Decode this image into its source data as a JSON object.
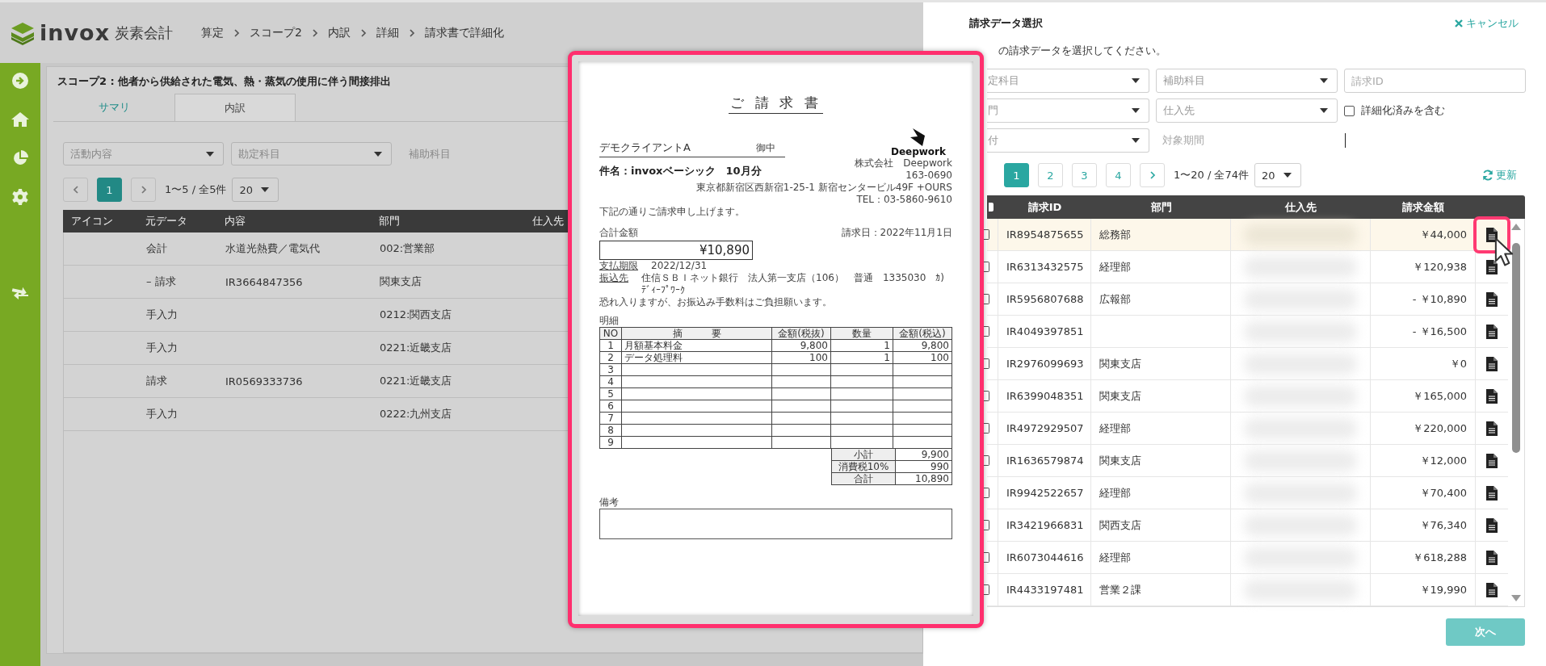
{
  "app": {
    "logo_text": "invox",
    "logo_suffix": "炭素会計",
    "breadcrumb": [
      "算定",
      "スコープ2",
      "内訳",
      "詳細",
      "請求書で詳細化"
    ]
  },
  "page": {
    "title": "スコープ2 : 他者から供給された電気、熱・蒸気の使用に伴う間接排出",
    "tabs": [
      {
        "label": "サマリ",
        "selected": false
      },
      {
        "label": "内訳",
        "selected": true
      }
    ],
    "filters": [
      {
        "kind": "select",
        "placeholder": "活動内容"
      },
      {
        "kind": "select",
        "placeholder": "勘定科目"
      },
      {
        "kind": "label",
        "text": "補助科目"
      }
    ],
    "pager": {
      "pages": [
        {
          "label": "1",
          "selected": true
        }
      ],
      "range": "1〜5 / 全5件",
      "page_size": "20"
    },
    "table": {
      "columns": [
        "アイコン",
        "元データ",
        "内容",
        "部門",
        "仕入先"
      ],
      "rows": [
        {
          "source": "会計",
          "content": "水道光熱費／電気代",
          "department": "002:営業部"
        },
        {
          "source": "– 請求",
          "content": "IR3664847356",
          "department": "関東支店"
        },
        {
          "source": "手入力",
          "department": "0212:関西支店"
        },
        {
          "source": "手入力",
          "department": "0221:近畿支店"
        },
        {
          "source": "請求",
          "content": "IR0569333736",
          "department": "0221:近畿支店"
        },
        {
          "source": "手入力",
          "department": "0222:九州支店"
        }
      ]
    }
  },
  "preview": {
    "title": "ご 請 求 書",
    "client": "デモクライアントA",
    "client_suffix": "御中",
    "subject": "件名：invoxベーシック　10月分",
    "company": {
      "logo_text": "Deepwork",
      "name": "株式会社　Deepwork",
      "postal": "163-0690",
      "address": "東京都新宿区西新宿1-25-1 新宿センタービル49F +OURS",
      "tel": "TEL：03-5860-9610"
    },
    "greeting": "下記の通りご請求申し上げます。",
    "total_label": "合計金額",
    "issue_date": "請求日：2022年11月1日",
    "total_amount": "¥10,890",
    "due_label": "支払期限",
    "due_date": "2022/12/31",
    "bank_label": "振込先",
    "bank": "住信ＳＢＩネット銀行　法人第一支店（106）　普通　1335030　ｶ)ﾃﾞｨｰﾌﾟﾜｰｸ",
    "note": "恐れ入りますが、お振込み手数料はご負担願います。",
    "details_label": "明細",
    "columns": [
      "NO",
      "摘　　　要",
      "金額(税抜)",
      "数量",
      "金額(税込)"
    ],
    "rows": [
      {
        "no": "1",
        "description": "月額基本料金",
        "amount_ex": "9,800",
        "quantity": "1",
        "amount_in": "9,800"
      },
      {
        "no": "2",
        "description": "データ処理料",
        "amount_ex": "100",
        "quantity": "1",
        "amount_in": "100"
      },
      {
        "no": "3"
      },
      {
        "no": "4"
      },
      {
        "no": "5"
      },
      {
        "no": "6"
      },
      {
        "no": "7"
      },
      {
        "no": "8"
      },
      {
        "no": "9"
      }
    ],
    "summary": [
      {
        "label": "小計",
        "value": "9,900"
      },
      {
        "label": "消費税10%",
        "value": "990"
      },
      {
        "label": "合計",
        "value": "10,890"
      }
    ],
    "remarks_label": "備考"
  },
  "drawer": {
    "title": "請求データ選択",
    "cancel": "キャンセル",
    "instruction": "の請求データを選択してください。",
    "filters": [
      {
        "kind": "select",
        "placeholder": "定科目"
      },
      {
        "kind": "select",
        "placeholder": "補助科目"
      },
      {
        "kind": "input",
        "placeholder": "請求ID"
      },
      {
        "kind": "select",
        "placeholder": "門"
      },
      {
        "kind": "select",
        "placeholder": "仕入先"
      },
      {
        "kind": "checkbox",
        "label": "詳細化済みを含む",
        "checked": false
      },
      {
        "kind": "select",
        "placeholder": "付"
      },
      {
        "kind": "label",
        "text": "対象期間"
      },
      {
        "kind": "caret"
      }
    ],
    "pager": {
      "pages": [
        {
          "label": "1",
          "selected": true
        },
        {
          "label": "2",
          "selected": false
        },
        {
          "label": "3",
          "selected": false
        },
        {
          "label": "4",
          "selected": false
        }
      ],
      "range": "1〜20 / 全74件",
      "page_size": "20"
    },
    "refresh": "更新",
    "table": {
      "select_all_checked": false,
      "columns": [
        "請求ID",
        "部門",
        "仕入先",
        "請求金額"
      ],
      "rows": [
        {
          "id": "IR8954875655",
          "department": "総務部",
          "amount": "￥44,000",
          "checked": false,
          "selected": true,
          "preview_open": true
        },
        {
          "id": "IR6313432575",
          "department": "経理部",
          "amount": "￥120,938",
          "checked": false,
          "selected": false,
          "preview_open": false
        },
        {
          "id": "IR5956807688",
          "department": "広報部",
          "amount": "- ￥10,890",
          "checked": false,
          "selected": false,
          "preview_open": false
        },
        {
          "id": "IR4049397851",
          "amount": "- ￥16,500",
          "checked": false,
          "selected": false,
          "preview_open": false
        },
        {
          "id": "IR2976099693",
          "department": "関東支店",
          "amount": "￥0",
          "checked": false,
          "selected": false,
          "preview_open": false
        },
        {
          "id": "IR6399048351",
          "department": "関東支店",
          "amount": "￥165,000",
          "checked": false,
          "selected": false,
          "preview_open": false
        },
        {
          "id": "IR4972929507",
          "department": "経理部",
          "amount": "￥220,000",
          "checked": false,
          "selected": false,
          "preview_open": false
        },
        {
          "id": "IR1636579874",
          "department": "関東支店",
          "amount": "￥12,000",
          "checked": false,
          "selected": false,
          "preview_open": false
        },
        {
          "id": "IR9942522657",
          "department": "経理部",
          "amount": "￥70,400",
          "checked": false,
          "selected": false,
          "preview_open": false
        },
        {
          "id": "IR3421966831",
          "department": "関西支店",
          "amount": "￥76,340",
          "checked": false,
          "selected": false,
          "preview_open": false
        },
        {
          "id": "IR6073044616",
          "department": "経理部",
          "amount": "￥618,288",
          "checked": false,
          "selected": false,
          "preview_open": false
        },
        {
          "id": "IR4433197481",
          "department": "営業２課",
          "amount": "￥19,990",
          "checked": false,
          "selected": false,
          "preview_open": false
        }
      ]
    },
    "next_button": "次へ"
  }
}
